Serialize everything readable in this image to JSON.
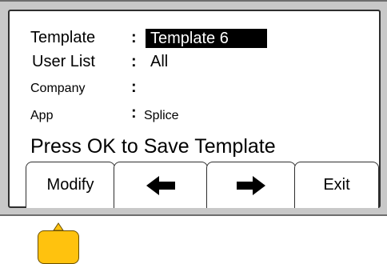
{
  "fields": {
    "template": {
      "label": "Template",
      "value": "Template 6"
    },
    "user_list": {
      "label": "User List",
      "value": "All"
    },
    "company": {
      "label": "Company",
      "value": ""
    },
    "app": {
      "label": "App",
      "value": "Splice"
    },
    "separator": ":"
  },
  "prompt": "Press OK to Save Template",
  "softkeys": {
    "modify": "Modify",
    "left": "left-arrow-icon",
    "right": "right-arrow-icon",
    "exit": "Exit"
  },
  "colors": {
    "frame": "#c8c8c8",
    "screen_bg": "#ffffff",
    "highlight_bg": "#000000",
    "ok_button": "#ffc20e"
  }
}
